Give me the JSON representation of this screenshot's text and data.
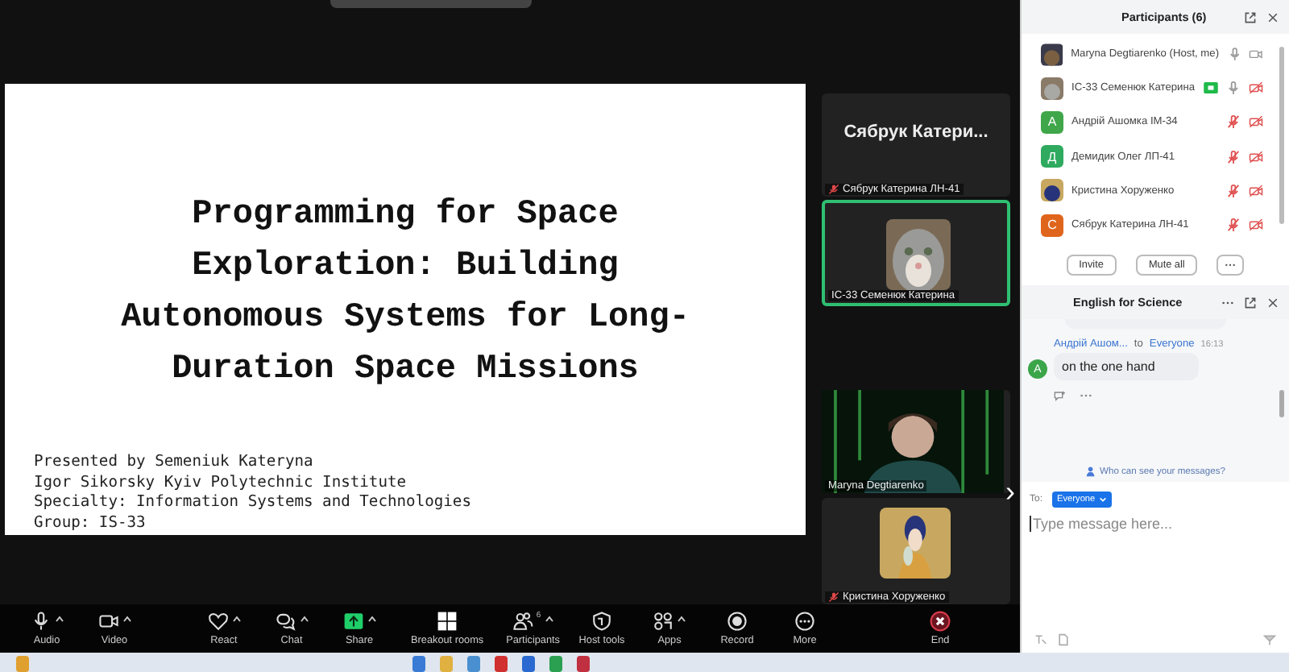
{
  "slide": {
    "title": "Programming for Space Exploration: Building Autonomous Systems for Long-Duration Space Missions",
    "lines": [
      "Presented by Semeniuk Kateryna",
      "Igor Sikorsky Kyiv Polytechnic Institute",
      "Specialty: Information Systems and Technologies",
      "Group: IS-33"
    ]
  },
  "tiles": [
    {
      "kind": "name",
      "display": "Сябрук  Катери...",
      "label": "Сябрук Катерина ЛН-41",
      "muted": true,
      "speaking": false
    },
    {
      "kind": "picture",
      "label": "IC-33 Семенюк Катерина",
      "muted": false,
      "speaking": true
    },
    {
      "kind": "picture",
      "label": "Maryna Degtiarenko",
      "muted": false,
      "speaking": false
    },
    {
      "kind": "picture",
      "label": "Кристина Хоруженко",
      "muted": true,
      "speaking": false
    }
  ],
  "next_page": "›",
  "toolbar": [
    {
      "label": "Audio",
      "caret": true
    },
    {
      "label": "Video",
      "caret": true
    },
    {
      "label": "React",
      "caret": true
    },
    {
      "label": "Chat",
      "caret": true
    },
    {
      "label": "Share",
      "caret": true
    },
    {
      "label": "Breakout rooms",
      "caret": false
    },
    {
      "label": "Participants",
      "caret": true,
      "count": "6"
    },
    {
      "label": "Host tools",
      "caret": false
    },
    {
      "label": "Apps",
      "caret": true
    },
    {
      "label": "Record",
      "caret": false
    },
    {
      "label": "More",
      "caret": false
    },
    {
      "label": "End",
      "caret": false
    }
  ],
  "participants": {
    "title": "Participants (6)",
    "items": [
      {
        "name": "Maryna Degtiarenko (Host, me)",
        "muted": false,
        "video_off": false,
        "sharing": false
      },
      {
        "name": "IC-33 Семенюк Катерина",
        "muted": false,
        "video_off": true,
        "sharing": true
      },
      {
        "name": "Андрій Ашомка ІМ-34",
        "avatar": {
          "kind": "letter",
          "letter": "А",
          "color": "#3fa64a"
        },
        "muted": true,
        "video_off": true,
        "sharing": false
      },
      {
        "name": "Демидик Олег ЛП-41",
        "avatar": {
          "kind": "letter",
          "letter": "Д",
          "color": "#2faa5f"
        },
        "muted": true,
        "video_off": true,
        "sharing": false
      },
      {
        "name": "Кристина Хоруженко",
        "muted": true,
        "video_off": true,
        "sharing": false
      },
      {
        "name": "Сябрук Катерина ЛН-41",
        "avatar": {
          "kind": "letter",
          "letter": "С",
          "color": "#e0651c"
        },
        "muted": true,
        "video_off": true,
        "sharing": false
      }
    ],
    "buttons": [
      "Invite",
      "Mute all"
    ]
  },
  "chat": {
    "title": "English for Science",
    "message": {
      "avatar": "A",
      "sender": "Андрій Ашом...",
      "to": "to",
      "recipient": "Everyone",
      "time": "16:13",
      "text": "on the one hand"
    },
    "privacy": "Who can see your messages?",
    "to_label": "To:",
    "recipient": "Everyone",
    "placeholder": "Type message here..."
  }
}
